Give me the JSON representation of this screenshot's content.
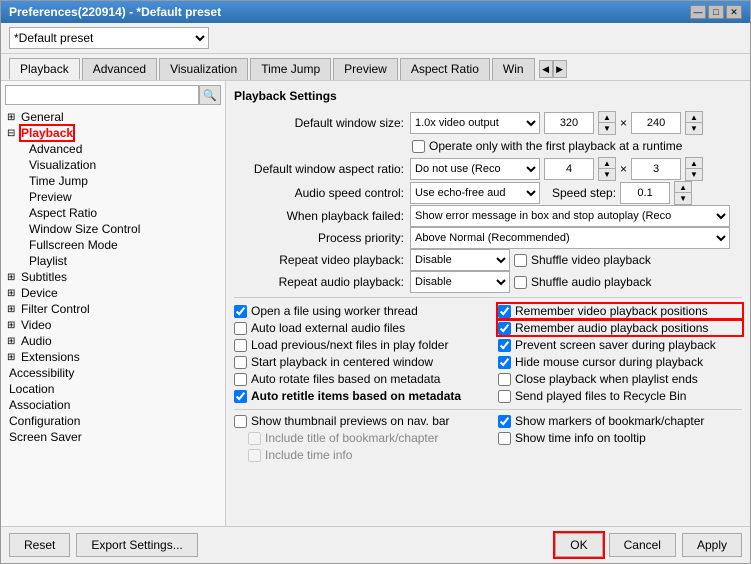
{
  "window": {
    "title": "Preferences(220914) - *Default preset",
    "titleButtons": [
      "—",
      "□",
      "✕"
    ]
  },
  "preset": {
    "selected": "*Default preset",
    "options": [
      "*Default preset"
    ]
  },
  "tabs": [
    {
      "label": "Playback",
      "active": true
    },
    {
      "label": "Advanced"
    },
    {
      "label": "Visualization"
    },
    {
      "label": "Time Jump"
    },
    {
      "label": "Preview"
    },
    {
      "label": "Aspect Ratio"
    },
    {
      "label": "Win"
    }
  ],
  "sidebar": {
    "search_placeholder": "",
    "items": [
      {
        "label": "General",
        "type": "parent",
        "expanded": true,
        "children": []
      },
      {
        "label": "Playback",
        "type": "parent",
        "expanded": true,
        "selected": true,
        "children": [
          {
            "label": "Advanced"
          },
          {
            "label": "Visualization"
          },
          {
            "label": "Time Jump"
          },
          {
            "label": "Preview"
          },
          {
            "label": "Aspect Ratio"
          },
          {
            "label": "Window Size Control"
          },
          {
            "label": "Fullscreen Mode"
          },
          {
            "label": "Playlist"
          }
        ]
      },
      {
        "label": "Subtitles",
        "type": "parent",
        "expanded": false,
        "children": []
      },
      {
        "label": "Device",
        "type": "parent",
        "expanded": false,
        "children": []
      },
      {
        "label": "Filter Control",
        "type": "parent",
        "expanded": false,
        "children": []
      },
      {
        "label": "Video",
        "type": "parent",
        "expanded": false,
        "children": []
      },
      {
        "label": "Audio",
        "type": "parent",
        "expanded": false,
        "children": []
      },
      {
        "label": "Extensions",
        "type": "parent",
        "expanded": false,
        "children": []
      },
      {
        "label": "Accessibility",
        "type": "leaf"
      },
      {
        "label": "Location",
        "type": "leaf"
      },
      {
        "label": "Association",
        "type": "leaf"
      },
      {
        "label": "Configuration",
        "type": "leaf"
      },
      {
        "label": "Screen Saver",
        "type": "leaf"
      }
    ]
  },
  "playback": {
    "section_title": "Playback Settings",
    "default_window_size_label": "Default window size:",
    "default_window_size_value": "1.0x video output",
    "width_value": "320",
    "height_value": "240",
    "operate_only_label": "Operate only with the first playback at a runtime",
    "default_window_aspect_label": "Default window aspect ratio:",
    "aspect_value": "Do not use (Reco",
    "aspect_num1": "4",
    "aspect_num2": "3",
    "audio_speed_label": "Audio speed control:",
    "audio_speed_value": "Use echo-free aud",
    "speed_step_label": "Speed step:",
    "speed_step_value": "0.1",
    "when_playback_failed_label": "When playback failed:",
    "when_playback_failed_value": "Show error message in box and stop autoplay (Reco",
    "process_priority_label": "Process priority:",
    "process_priority_value": "Above Normal (Recommended)",
    "repeat_video_label": "Repeat video playback:",
    "repeat_video_value": "Disable",
    "shuffle_video_label": "Shuffle video playback",
    "repeat_audio_label": "Repeat audio playback:",
    "repeat_audio_value": "Disable",
    "shuffle_audio_label": "Shuffle audio playback",
    "checkboxes_left": [
      {
        "label": "Open a file using worker thread",
        "checked": true
      },
      {
        "label": "Auto load external audio files",
        "checked": false
      },
      {
        "label": "Load previous/next files in play folder",
        "checked": false
      },
      {
        "label": "Start playback in centered window",
        "checked": false
      },
      {
        "label": "Auto rotate files based on metadata",
        "checked": false
      },
      {
        "label": "Auto retitle items based on metadata",
        "checked": true,
        "bold": true
      }
    ],
    "checkboxes_right": [
      {
        "label": "Remember video playback positions",
        "checked": true,
        "highlight": true
      },
      {
        "label": "Remember audio playback positions",
        "checked": true,
        "highlight": true
      },
      {
        "label": "Prevent screen saver during playback",
        "checked": true
      },
      {
        "label": "Hide mouse cursor during playback",
        "checked": true
      },
      {
        "label": "Close playback when playlist ends",
        "checked": false
      },
      {
        "label": "Send played files to Recycle Bin",
        "checked": false
      }
    ],
    "checkboxes_bottom_left": [
      {
        "label": "Show thumbnail previews on nav. bar",
        "checked": false
      },
      {
        "label": "Include title of bookmark/chapter",
        "checked": false,
        "disabled": true
      },
      {
        "label": "Include time info",
        "checked": false,
        "disabled": true
      }
    ],
    "checkboxes_bottom_right": [
      {
        "label": "Show markers of bookmark/chapter",
        "checked": true
      },
      {
        "label": "Show time info on tooltip",
        "checked": false
      }
    ]
  },
  "bottom": {
    "reset_label": "Reset",
    "export_label": "Export Settings...",
    "ok_label": "OK",
    "cancel_label": "Cancel",
    "apply_label": "Apply"
  }
}
